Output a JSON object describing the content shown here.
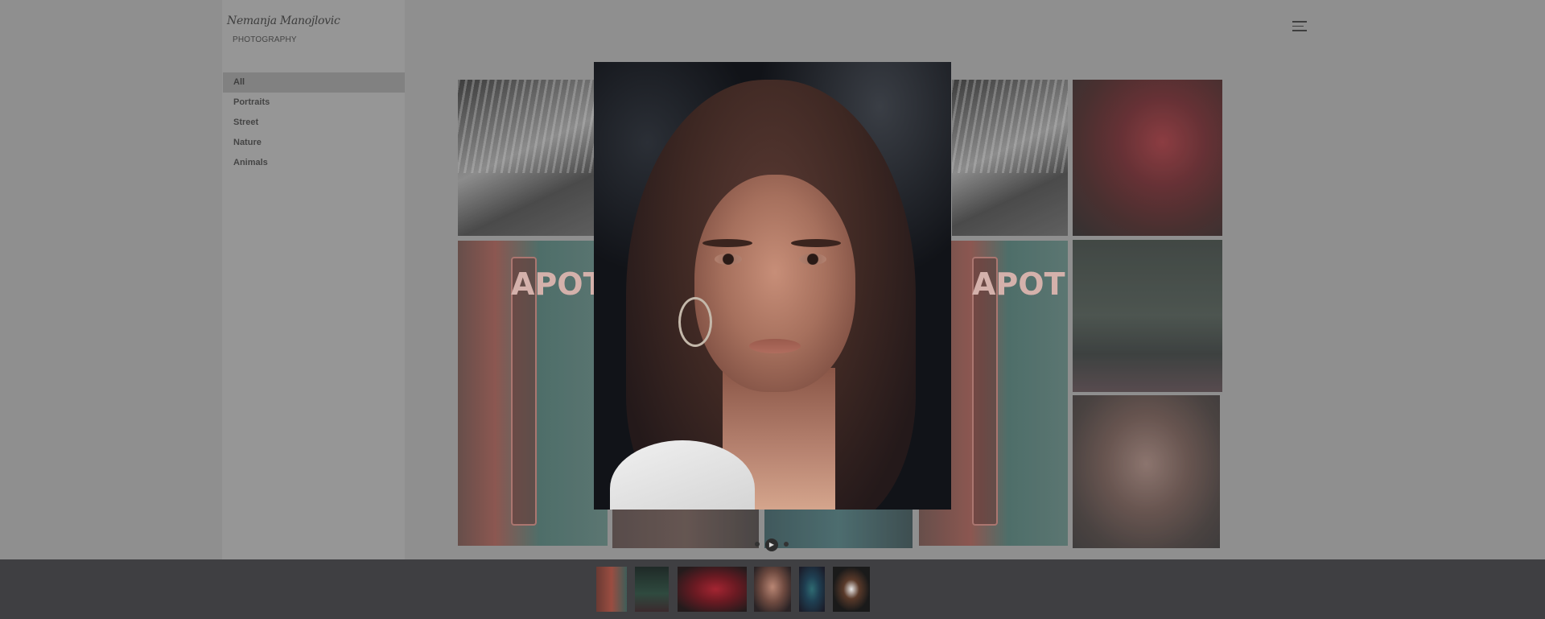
{
  "brand": {
    "script_name": "Nemanja Manojlovic",
    "subtitle": "PHOTOGRAPHY"
  },
  "sidebar": {
    "items": [
      {
        "label": "All",
        "active": true
      },
      {
        "label": "Portraits",
        "active": false
      },
      {
        "label": "Street",
        "active": false
      },
      {
        "label": "Nature",
        "active": false
      },
      {
        "label": "Animals",
        "active": false
      }
    ]
  },
  "header": {
    "menu_icon": "hamburger-menu-icon"
  },
  "gallery": {
    "apotek_sign_text": "APOTEK"
  },
  "lightbox": {
    "image": "portrait-woman",
    "controls": [
      "prev-dot",
      "play",
      "next-dot"
    ],
    "play_glyph": "▶"
  },
  "thumbnails": [
    {
      "name": "apotek-sign"
    },
    {
      "name": "night-street"
    },
    {
      "name": "red-rose"
    },
    {
      "name": "portrait-woman",
      "selected": true
    },
    {
      "name": "blue-flowers"
    },
    {
      "name": "dog"
    }
  ],
  "colors": {
    "overlay": "#8e8e8e",
    "strip": "#3f3f42",
    "text": "#333333"
  }
}
